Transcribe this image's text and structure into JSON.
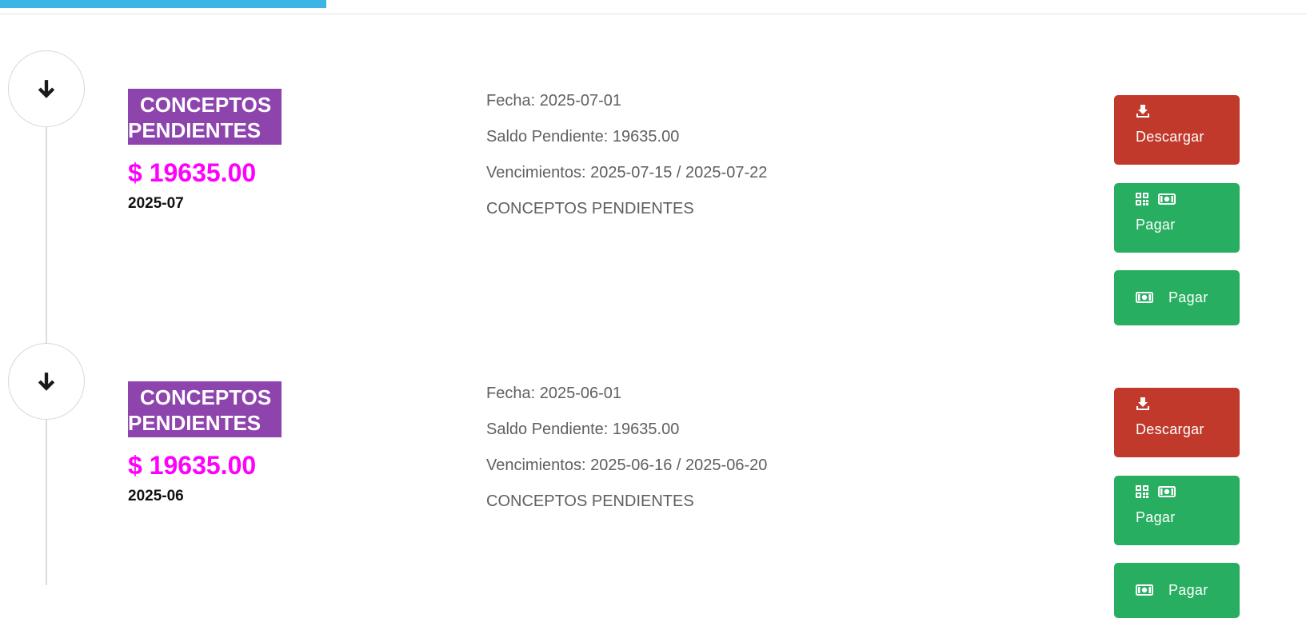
{
  "progress": {
    "fraction": 0.25,
    "color": "#3ab5e6"
  },
  "colors": {
    "tag_bg": "#8e44ad",
    "amount": "#ff00ff",
    "download_button": "#c0392b",
    "pay_button": "#27ae60"
  },
  "entries": [
    {
      "tag_line1": "CONCEPTOS",
      "tag_line2": "PENDIENTES",
      "amount": "$ 19635.00",
      "period": "2025-07",
      "fecha": "Fecha: 2025-07-01",
      "saldo": "Saldo Pendiente: 19635.00",
      "vencimientos": "Vencimientos: 2025-07-15 / 2025-07-22",
      "concepto": "CONCEPTOS PENDIENTES",
      "download_label": "Descargar",
      "pay_qr_label": "Pagar",
      "pay_cash_label": "Pagar",
      "icons": [
        "arrow-down-icon",
        "download-icon",
        "qr-code-icon",
        "money-bill-icon"
      ]
    },
    {
      "tag_line1": "CONCEPTOS",
      "tag_line2": "PENDIENTES",
      "amount": "$ 19635.00",
      "period": "2025-06",
      "fecha": "Fecha: 2025-06-01",
      "saldo": "Saldo Pendiente: 19635.00",
      "vencimientos": "Vencimientos: 2025-06-16 / 2025-06-20",
      "concepto": "CONCEPTOS PENDIENTES",
      "download_label": "Descargar",
      "pay_qr_label": "Pagar",
      "pay_cash_label": "Pagar",
      "icons": [
        "arrow-down-icon",
        "download-icon",
        "qr-code-icon",
        "money-bill-icon"
      ]
    }
  ]
}
